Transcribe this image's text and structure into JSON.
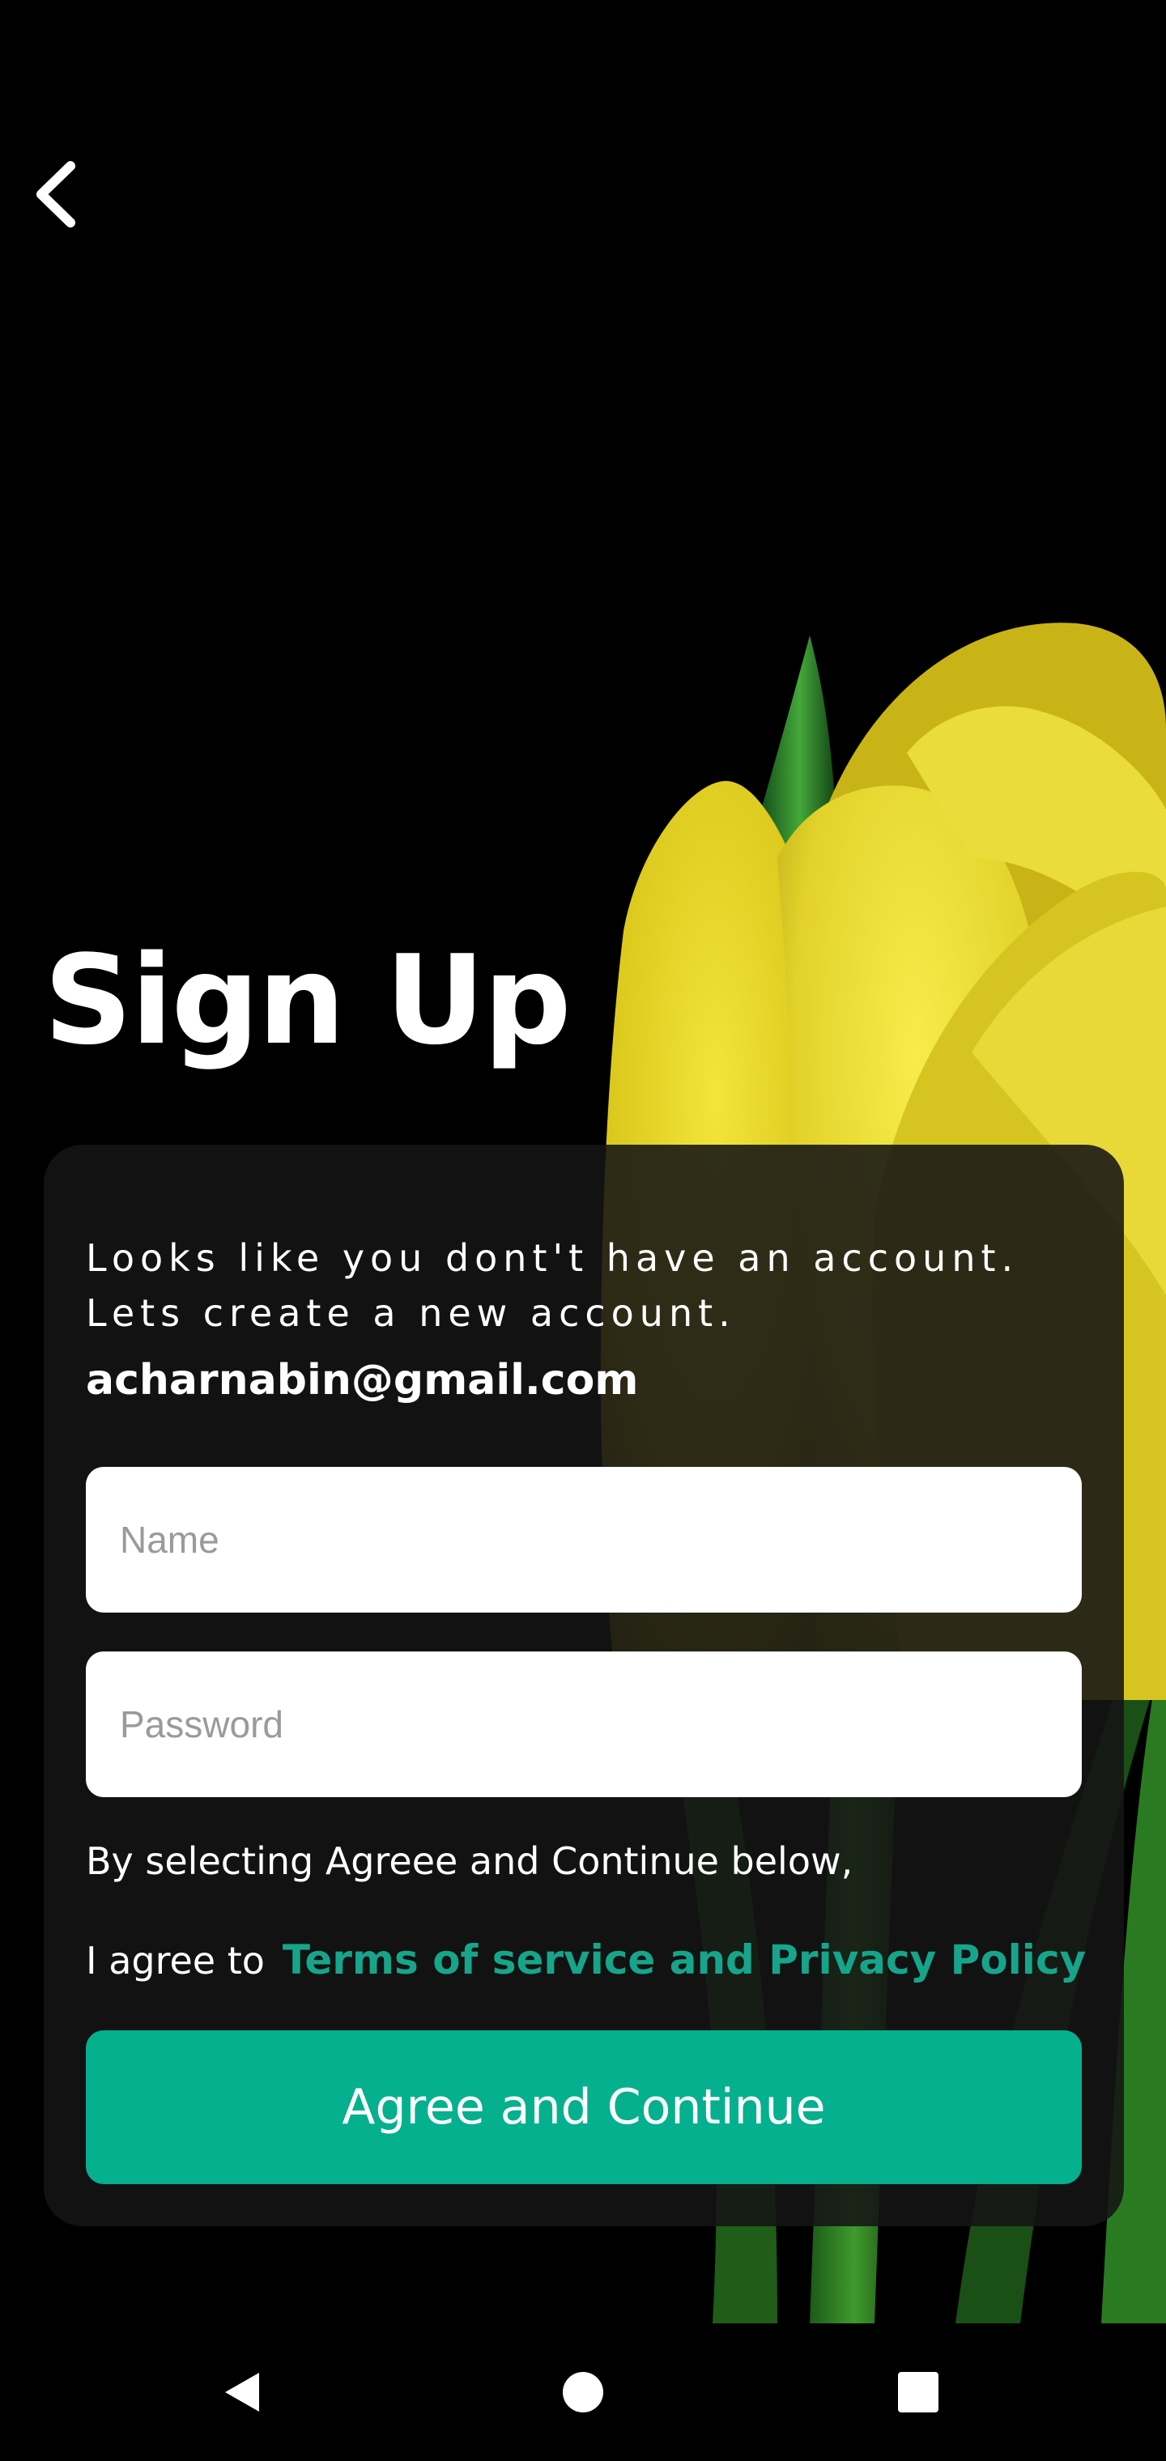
{
  "header": {
    "back_icon": "chevron-left-icon"
  },
  "page": {
    "title": "Sign Up"
  },
  "card": {
    "intro_line_1": "Looks like you dont't have an account.",
    "intro_line_2": "Lets create a new account.",
    "email": "acharnabin@gmail.com",
    "name_placeholder": "Name",
    "password_placeholder": "Password",
    "consent_line_1": "By selecting Agreee and Continue below,",
    "consent_prefix": "I agree to",
    "consent_link": "Terms of service and Privacy Policy",
    "agree_button": "Agree and Continue"
  },
  "colors": {
    "accent": "#05b08e",
    "link": "#16a58a",
    "background": "#000000",
    "card": "#141414"
  },
  "navbar": {
    "back_icon": "triangle-back-icon",
    "home_icon": "circle-home-icon",
    "recents_icon": "square-recents-icon"
  }
}
